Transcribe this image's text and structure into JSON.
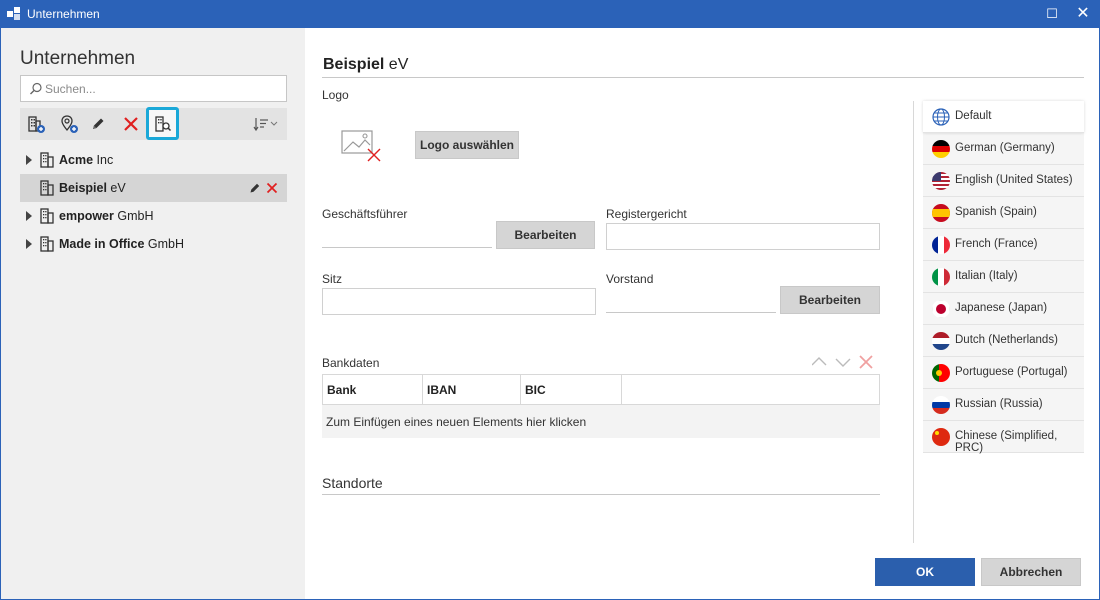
{
  "window": {
    "title": "Unternehmen",
    "maximize_glyph": "☐",
    "close_glyph": "✕"
  },
  "sidebar": {
    "heading": "Unternehmen",
    "search_placeholder": "Suchen...",
    "toolbar_icons": [
      "add-company-icon",
      "add-location-icon",
      "edit-icon",
      "delete-icon",
      "company-search-icon",
      "sort-icon"
    ],
    "items": [
      {
        "name": "Acme",
        "suffix": " Inc"
      },
      {
        "name": "Beispiel",
        "suffix": " eV"
      },
      {
        "name": "empower",
        "suffix": " GmbH"
      },
      {
        "name": "Made in Office",
        "suffix": " GmbH"
      }
    ]
  },
  "detail": {
    "company_name": "Beispiel",
    "company_suffix": " eV",
    "logo_label": "Logo",
    "logo_button": "Logo auswählen",
    "ceo_label": "Geschäftsführer",
    "ceo_edit_button": "Bearbeiten",
    "register_court_label": "Registergericht",
    "seat_label": "Sitz",
    "board_label": "Vorstand",
    "board_edit_button": "Bearbeiten",
    "bank_label": "Bankdaten",
    "bank_columns": [
      "Bank",
      "IBAN",
      "BIC"
    ],
    "bank_new_row": "Zum Einfügen eines neuen Elements hier klicken",
    "locations_label": "Standorte"
  },
  "languages": [
    {
      "label": "Default",
      "icon": "globe-icon"
    },
    {
      "label": "German (Germany)",
      "icon": "flag-de"
    },
    {
      "label": "English (United States)",
      "icon": "flag-us"
    },
    {
      "label": "Spanish (Spain)",
      "icon": "flag-es"
    },
    {
      "label": "French (France)",
      "icon": "flag-fr"
    },
    {
      "label": "Italian (Italy)",
      "icon": "flag-it"
    },
    {
      "label": "Japanese (Japan)",
      "icon": "flag-jp"
    },
    {
      "label": "Dutch (Netherlands)",
      "icon": "flag-nl"
    },
    {
      "label": "Portuguese (Portugal)",
      "icon": "flag-pt"
    },
    {
      "label": "Russian (Russia)",
      "icon": "flag-ru"
    },
    {
      "label": "Chinese (Simplified, PRC)",
      "icon": "flag-cn"
    }
  ],
  "footer": {
    "ok": "OK",
    "cancel": "Abbrechen"
  },
  "colors": {
    "accent": "#2b62b8",
    "selected_outline": "#1aa8d8",
    "delete_red": "#e02020"
  }
}
